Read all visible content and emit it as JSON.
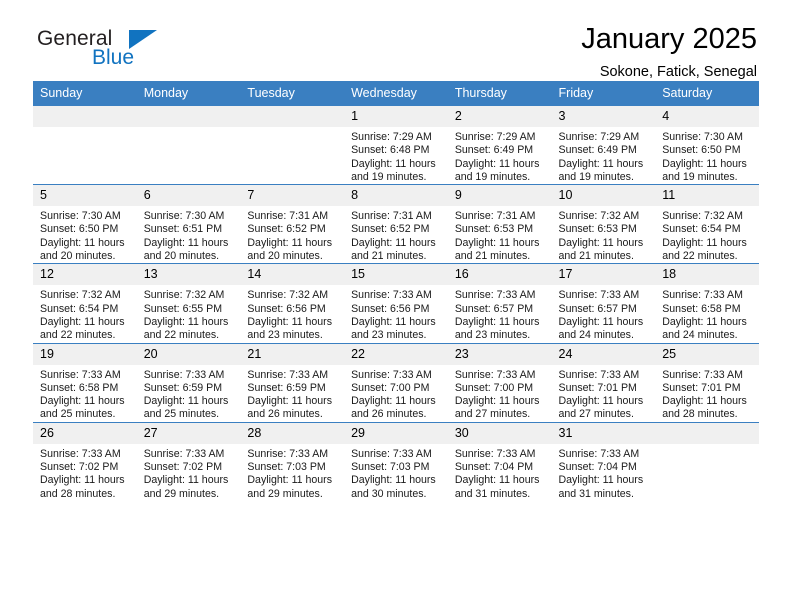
{
  "logo": {
    "word1": "General",
    "word2": "Blue",
    "triangle_color": "#1173c0"
  },
  "header": {
    "title": "January 2025",
    "location": "Sokone, Fatick, Senegal"
  },
  "calendar": {
    "header_bg": "#3a7fc1",
    "daynum_bg": "#f0f0f0",
    "weekdays": [
      "Sunday",
      "Monday",
      "Tuesday",
      "Wednesday",
      "Thursday",
      "Friday",
      "Saturday"
    ],
    "labels": {
      "sunrise": "Sunrise:",
      "sunset": "Sunset:",
      "daylight": "Daylight:"
    },
    "weeks": [
      [
        {
          "day": "",
          "empty": true
        },
        {
          "day": "",
          "empty": true
        },
        {
          "day": "",
          "empty": true
        },
        {
          "day": "1",
          "sunrise": "Sunrise: 7:29 AM",
          "sunset": "Sunset: 6:48 PM",
          "daylight_1": "Daylight: 11 hours",
          "daylight_2": "and 19 minutes."
        },
        {
          "day": "2",
          "sunrise": "Sunrise: 7:29 AM",
          "sunset": "Sunset: 6:49 PM",
          "daylight_1": "Daylight: 11 hours",
          "daylight_2": "and 19 minutes."
        },
        {
          "day": "3",
          "sunrise": "Sunrise: 7:29 AM",
          "sunset": "Sunset: 6:49 PM",
          "daylight_1": "Daylight: 11 hours",
          "daylight_2": "and 19 minutes."
        },
        {
          "day": "4",
          "sunrise": "Sunrise: 7:30 AM",
          "sunset": "Sunset: 6:50 PM",
          "daylight_1": "Daylight: 11 hours",
          "daylight_2": "and 19 minutes."
        }
      ],
      [
        {
          "day": "5",
          "sunrise": "Sunrise: 7:30 AM",
          "sunset": "Sunset: 6:50 PM",
          "daylight_1": "Daylight: 11 hours",
          "daylight_2": "and 20 minutes."
        },
        {
          "day": "6",
          "sunrise": "Sunrise: 7:30 AM",
          "sunset": "Sunset: 6:51 PM",
          "daylight_1": "Daylight: 11 hours",
          "daylight_2": "and 20 minutes."
        },
        {
          "day": "7",
          "sunrise": "Sunrise: 7:31 AM",
          "sunset": "Sunset: 6:52 PM",
          "daylight_1": "Daylight: 11 hours",
          "daylight_2": "and 20 minutes."
        },
        {
          "day": "8",
          "sunrise": "Sunrise: 7:31 AM",
          "sunset": "Sunset: 6:52 PM",
          "daylight_1": "Daylight: 11 hours",
          "daylight_2": "and 21 minutes."
        },
        {
          "day": "9",
          "sunrise": "Sunrise: 7:31 AM",
          "sunset": "Sunset: 6:53 PM",
          "daylight_1": "Daylight: 11 hours",
          "daylight_2": "and 21 minutes."
        },
        {
          "day": "10",
          "sunrise": "Sunrise: 7:32 AM",
          "sunset": "Sunset: 6:53 PM",
          "daylight_1": "Daylight: 11 hours",
          "daylight_2": "and 21 minutes."
        },
        {
          "day": "11",
          "sunrise": "Sunrise: 7:32 AM",
          "sunset": "Sunset: 6:54 PM",
          "daylight_1": "Daylight: 11 hours",
          "daylight_2": "and 22 minutes."
        }
      ],
      [
        {
          "day": "12",
          "sunrise": "Sunrise: 7:32 AM",
          "sunset": "Sunset: 6:54 PM",
          "daylight_1": "Daylight: 11 hours",
          "daylight_2": "and 22 minutes."
        },
        {
          "day": "13",
          "sunrise": "Sunrise: 7:32 AM",
          "sunset": "Sunset: 6:55 PM",
          "daylight_1": "Daylight: 11 hours",
          "daylight_2": "and 22 minutes."
        },
        {
          "day": "14",
          "sunrise": "Sunrise: 7:32 AM",
          "sunset": "Sunset: 6:56 PM",
          "daylight_1": "Daylight: 11 hours",
          "daylight_2": "and 23 minutes."
        },
        {
          "day": "15",
          "sunrise": "Sunrise: 7:33 AM",
          "sunset": "Sunset: 6:56 PM",
          "daylight_1": "Daylight: 11 hours",
          "daylight_2": "and 23 minutes."
        },
        {
          "day": "16",
          "sunrise": "Sunrise: 7:33 AM",
          "sunset": "Sunset: 6:57 PM",
          "daylight_1": "Daylight: 11 hours",
          "daylight_2": "and 23 minutes."
        },
        {
          "day": "17",
          "sunrise": "Sunrise: 7:33 AM",
          "sunset": "Sunset: 6:57 PM",
          "daylight_1": "Daylight: 11 hours",
          "daylight_2": "and 24 minutes."
        },
        {
          "day": "18",
          "sunrise": "Sunrise: 7:33 AM",
          "sunset": "Sunset: 6:58 PM",
          "daylight_1": "Daylight: 11 hours",
          "daylight_2": "and 24 minutes."
        }
      ],
      [
        {
          "day": "19",
          "sunrise": "Sunrise: 7:33 AM",
          "sunset": "Sunset: 6:58 PM",
          "daylight_1": "Daylight: 11 hours",
          "daylight_2": "and 25 minutes."
        },
        {
          "day": "20",
          "sunrise": "Sunrise: 7:33 AM",
          "sunset": "Sunset: 6:59 PM",
          "daylight_1": "Daylight: 11 hours",
          "daylight_2": "and 25 minutes."
        },
        {
          "day": "21",
          "sunrise": "Sunrise: 7:33 AM",
          "sunset": "Sunset: 6:59 PM",
          "daylight_1": "Daylight: 11 hours",
          "daylight_2": "and 26 minutes."
        },
        {
          "day": "22",
          "sunrise": "Sunrise: 7:33 AM",
          "sunset": "Sunset: 7:00 PM",
          "daylight_1": "Daylight: 11 hours",
          "daylight_2": "and 26 minutes."
        },
        {
          "day": "23",
          "sunrise": "Sunrise: 7:33 AM",
          "sunset": "Sunset: 7:00 PM",
          "daylight_1": "Daylight: 11 hours",
          "daylight_2": "and 27 minutes."
        },
        {
          "day": "24",
          "sunrise": "Sunrise: 7:33 AM",
          "sunset": "Sunset: 7:01 PM",
          "daylight_1": "Daylight: 11 hours",
          "daylight_2": "and 27 minutes."
        },
        {
          "day": "25",
          "sunrise": "Sunrise: 7:33 AM",
          "sunset": "Sunset: 7:01 PM",
          "daylight_1": "Daylight: 11 hours",
          "daylight_2": "and 28 minutes."
        }
      ],
      [
        {
          "day": "26",
          "sunrise": "Sunrise: 7:33 AM",
          "sunset": "Sunset: 7:02 PM",
          "daylight_1": "Daylight: 11 hours",
          "daylight_2": "and 28 minutes."
        },
        {
          "day": "27",
          "sunrise": "Sunrise: 7:33 AM",
          "sunset": "Sunset: 7:02 PM",
          "daylight_1": "Daylight: 11 hours",
          "daylight_2": "and 29 minutes."
        },
        {
          "day": "28",
          "sunrise": "Sunrise: 7:33 AM",
          "sunset": "Sunset: 7:03 PM",
          "daylight_1": "Daylight: 11 hours",
          "daylight_2": "and 29 minutes."
        },
        {
          "day": "29",
          "sunrise": "Sunrise: 7:33 AM",
          "sunset": "Sunset: 7:03 PM",
          "daylight_1": "Daylight: 11 hours",
          "daylight_2": "and 30 minutes."
        },
        {
          "day": "30",
          "sunrise": "Sunrise: 7:33 AM",
          "sunset": "Sunset: 7:04 PM",
          "daylight_1": "Daylight: 11 hours",
          "daylight_2": "and 31 minutes."
        },
        {
          "day": "31",
          "sunrise": "Sunrise: 7:33 AM",
          "sunset": "Sunset: 7:04 PM",
          "daylight_1": "Daylight: 11 hours",
          "daylight_2": "and 31 minutes."
        },
        {
          "day": "",
          "empty": true
        }
      ]
    ]
  }
}
